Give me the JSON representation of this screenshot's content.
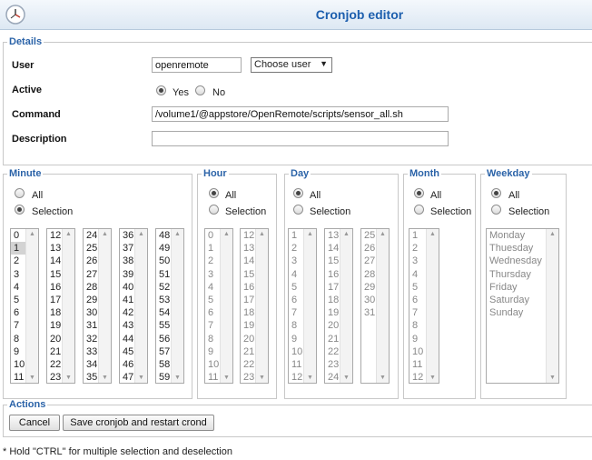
{
  "window": {
    "title": "Cronjob editor",
    "icon": "clock-icon"
  },
  "details": {
    "legend": "Details",
    "user": {
      "label": "User",
      "value": "openremote",
      "choose_label": "Choose user"
    },
    "active": {
      "label": "Active",
      "yes": "Yes",
      "no": "No",
      "selected": "Yes"
    },
    "command": {
      "label": "Command",
      "value": "/volume1/@appstore/OpenRemote/scripts/sensor_all.sh"
    },
    "description": {
      "label": "Description",
      "value": ""
    }
  },
  "minute": {
    "legend": "Minute",
    "all": "All",
    "selection": "Selection",
    "selected_mode": "Selection",
    "lists": [
      [
        "0",
        "1",
        "2",
        "3",
        "4",
        "5",
        "6",
        "7",
        "8",
        "9",
        "10",
        "11"
      ],
      [
        "12",
        "13",
        "14",
        "15",
        "16",
        "17",
        "18",
        "19",
        "20",
        "21",
        "22",
        "23"
      ],
      [
        "24",
        "25",
        "26",
        "27",
        "28",
        "29",
        "30",
        "31",
        "32",
        "33",
        "34",
        "35"
      ],
      [
        "36",
        "37",
        "38",
        "39",
        "40",
        "41",
        "42",
        "43",
        "44",
        "45",
        "46",
        "47"
      ],
      [
        "48",
        "49",
        "50",
        "51",
        "52",
        "53",
        "54",
        "55",
        "56",
        "57",
        "58",
        "59"
      ]
    ],
    "selected_value": "1"
  },
  "hour": {
    "legend": "Hour",
    "all": "All",
    "selection": "Selection",
    "selected_mode": "All",
    "lists": [
      [
        "0",
        "1",
        "2",
        "3",
        "4",
        "5",
        "6",
        "7",
        "8",
        "9",
        "10",
        "11"
      ],
      [
        "12",
        "13",
        "14",
        "15",
        "16",
        "17",
        "18",
        "19",
        "20",
        "21",
        "22",
        "23"
      ]
    ]
  },
  "day": {
    "legend": "Day",
    "all": "All",
    "selection": "Selection",
    "selected_mode": "All",
    "lists": [
      [
        "1",
        "2",
        "3",
        "4",
        "5",
        "6",
        "7",
        "8",
        "9",
        "10",
        "11",
        "12"
      ],
      [
        "13",
        "14",
        "15",
        "16",
        "17",
        "18",
        "19",
        "20",
        "21",
        "22",
        "23",
        "24"
      ],
      [
        "25",
        "26",
        "27",
        "28",
        "29",
        "30",
        "31"
      ]
    ]
  },
  "month": {
    "legend": "Month",
    "all": "All",
    "selection": "Selection",
    "selected_mode": "All",
    "lists": [
      [
        "1",
        "2",
        "3",
        "4",
        "5",
        "6",
        "7",
        "8",
        "9",
        "10",
        "11",
        "12"
      ]
    ]
  },
  "weekday": {
    "legend": "Weekday",
    "all": "All",
    "selection": "Selection",
    "selected_mode": "All",
    "lists": [
      [
        "Monday",
        "Thuesday",
        "Wednesday",
        "Thursday",
        "Friday",
        "Saturday",
        "Sunday"
      ]
    ]
  },
  "actions": {
    "legend": "Actions",
    "cancel": "Cancel",
    "save": "Save cronjob and restart crond"
  },
  "footnote": "* Hold \"CTRL\" for multiple selection and deselection",
  "colors": {
    "accent": "#2b63a8",
    "title": "#1d5fae",
    "selection": "#d3d3d3"
  }
}
